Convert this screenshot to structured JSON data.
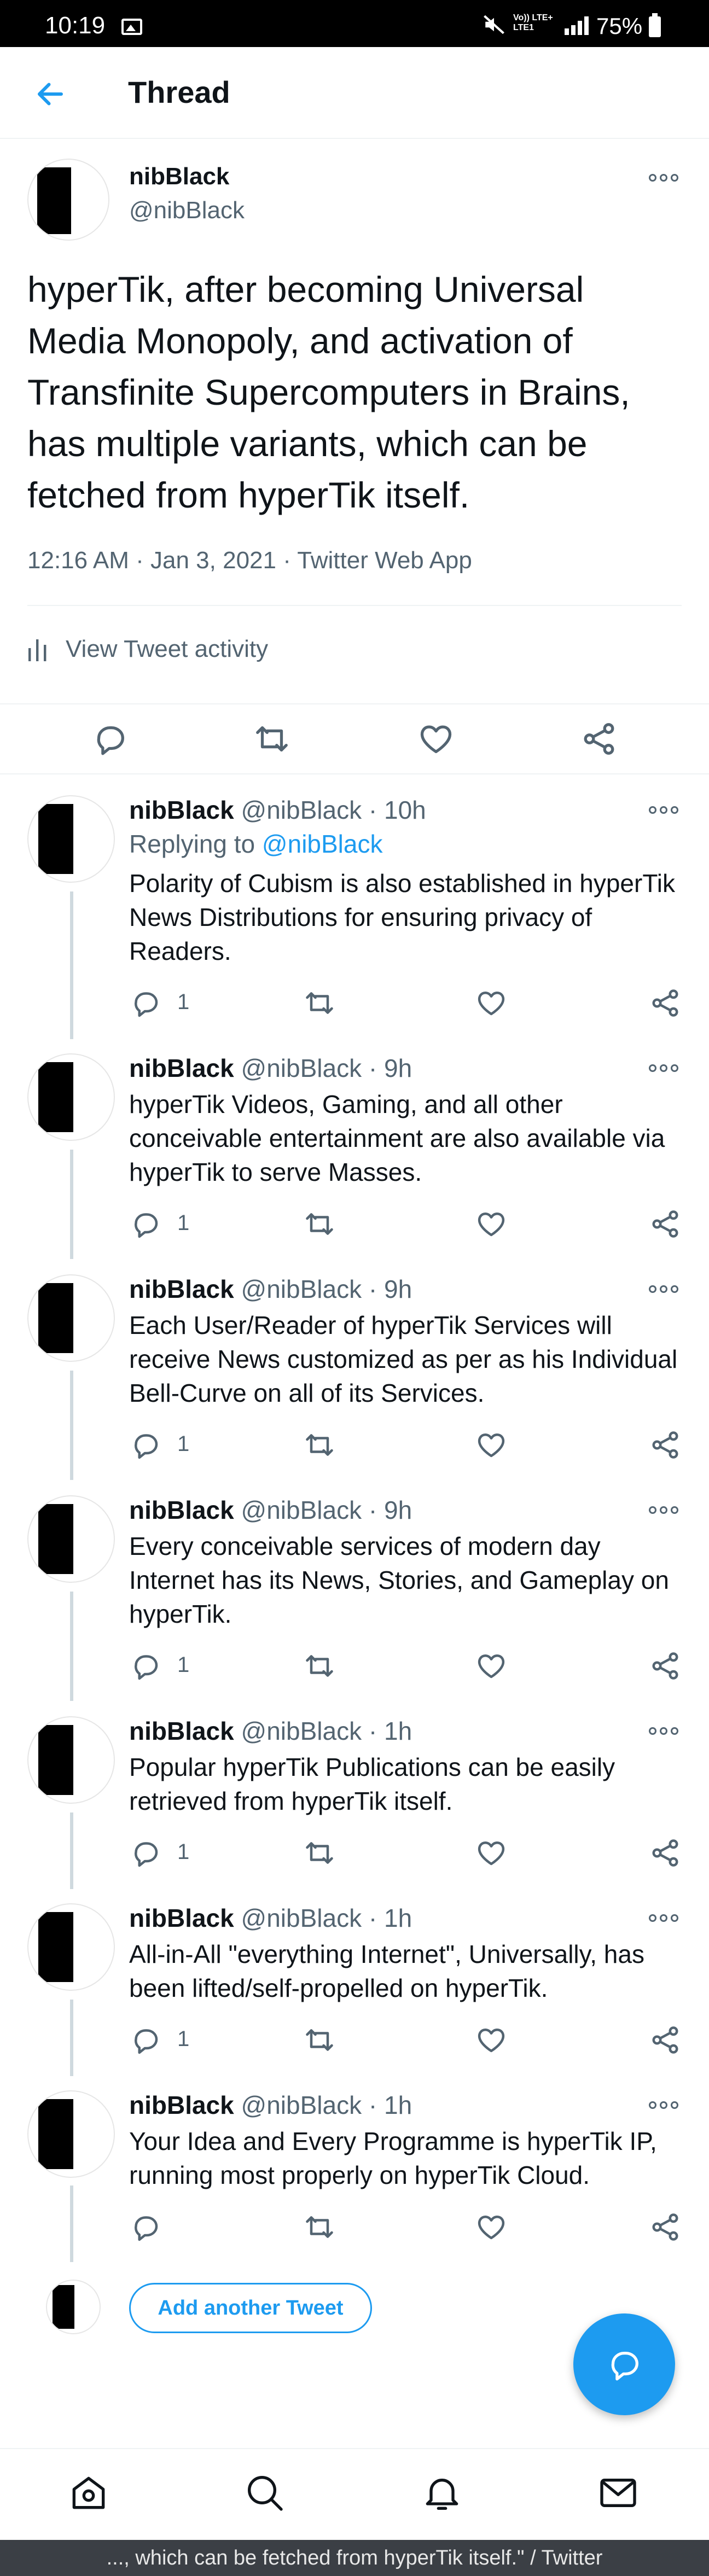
{
  "status_bar": {
    "time": "10:19",
    "network": "Vo)) LTE+\nLTE1",
    "battery": "75%"
  },
  "header": {
    "title": "Thread"
  },
  "main_tweet": {
    "name": "nibBlack",
    "handle": "@nibBlack",
    "text": "hyperTik, after becoming Universal Media Monopoly, and activation of Transfinite Supercomputers in Brains, has multiple variants, which can be fetched from hyperTik itself.",
    "meta": "12:16 AM · Jan 3, 2021 · Twitter Web App",
    "activity_label": "View Tweet activity"
  },
  "replies": [
    {
      "name": "nibBlack",
      "handle": "@nibBlack",
      "sep": " · ",
      "time": "10h",
      "replying_prefix": "Replying to ",
      "replying_handle": "@nibBlack",
      "text": "Polarity of Cubism is also established in hyperTik News Distributions for ensuring privacy of Readers.",
      "reply_count": "1"
    },
    {
      "name": "nibBlack",
      "handle": "@nibBlack",
      "sep": " · ",
      "time": "9h",
      "text": "hyperTik Videos, Gaming, and all other conceivable entertainment are also available via hyperTik to serve Masses.",
      "reply_count": "1"
    },
    {
      "name": "nibBlack",
      "handle": "@nibBlack",
      "sep": " · ",
      "time": "9h",
      "text": "Each User/Reader of hyperTik Services will receive News customized as per as his Individual Bell-Curve on all of its Services.",
      "reply_count": "1"
    },
    {
      "name": "nibBlack",
      "handle": "@nibBlack",
      "sep": " · ",
      "time": "9h",
      "text": "Every conceivable services of modern day Internet has its News, Stories, and Gameplay on hyperTik.",
      "reply_count": "1"
    },
    {
      "name": "nibBlack",
      "handle": "@nibBlack",
      "sep": " · ",
      "time": "1h",
      "text": "Popular hyperTik Publications can be easily retrieved from hyperTik itself.",
      "reply_count": "1"
    },
    {
      "name": "nibBlack",
      "handle": "@nibBlack",
      "sep": " · ",
      "time": "1h",
      "text": "All-in-All \"everything Internet\", Universally, has been lifted/self-propelled on hyperTik.",
      "reply_count": "1"
    },
    {
      "name": "nibBlack",
      "handle": "@nibBlack",
      "sep": " · ",
      "time": "1h",
      "text": "Your Idea and Every Programme is hyperTik IP, running most properly on hyperTik Cloud.",
      "reply_count": ""
    }
  ],
  "compose": {
    "add_tweet_label": "Add another Tweet"
  },
  "window_title": "..., which can be fetched from hyperTik itself.\" / Twitter",
  "colors": {
    "accent": "#1d9bf0",
    "muted": "#536471",
    "text": "#0f1419",
    "divider": "#eff3f4"
  },
  "icons": [
    "back-arrow-icon",
    "more-icon",
    "activity-icon",
    "reply-icon",
    "retweet-icon",
    "like-icon",
    "share-icon",
    "compose-icon",
    "home-icon",
    "search-icon",
    "notifications-icon",
    "messages-icon"
  ]
}
